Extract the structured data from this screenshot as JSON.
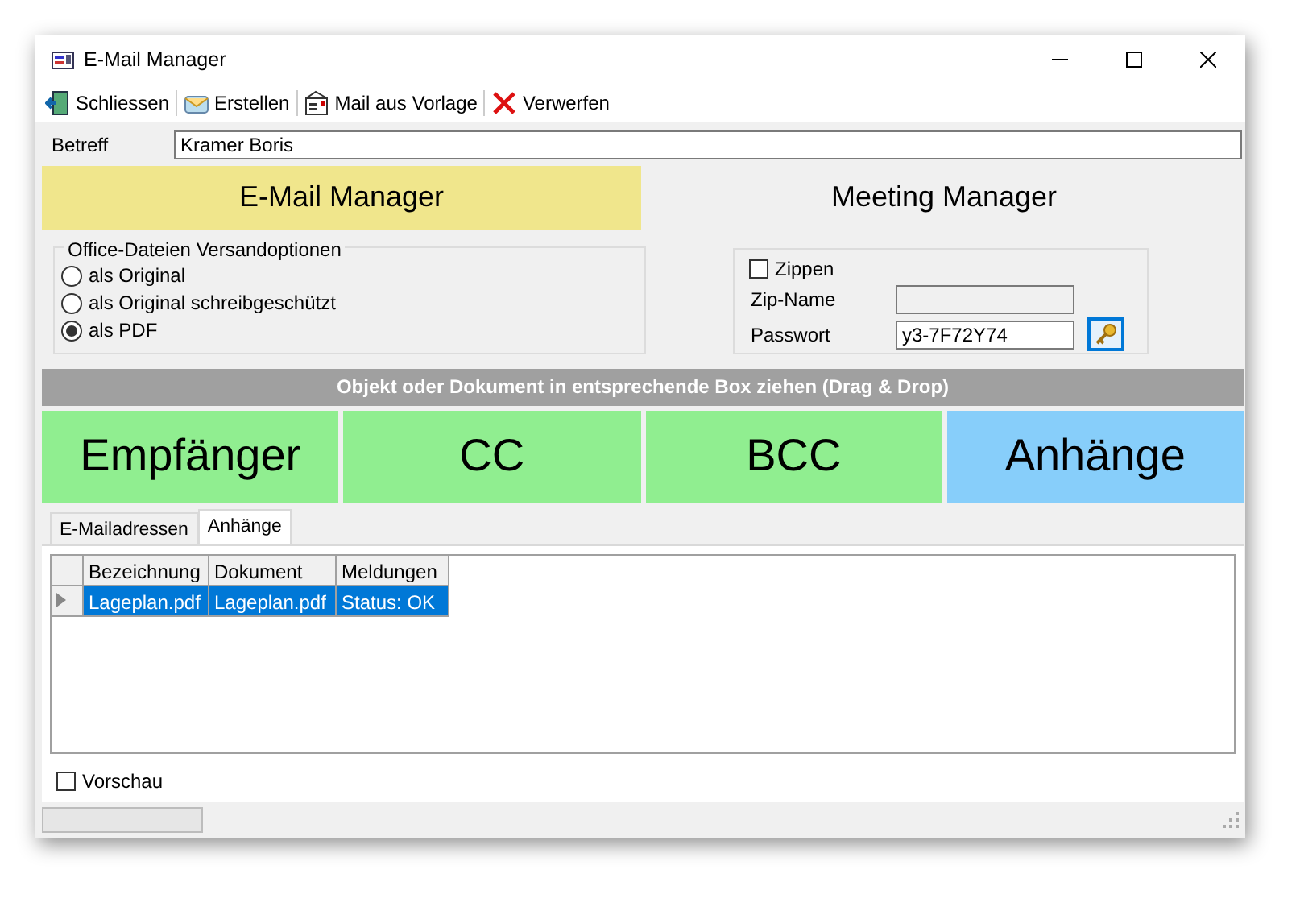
{
  "window": {
    "title": "E-Mail Manager"
  },
  "toolbar": [
    {
      "kind": "close",
      "label": "Schliessen"
    },
    {
      "kind": "create",
      "label": "Erstellen"
    },
    {
      "kind": "template",
      "label": "Mail aus Vorlage"
    },
    {
      "kind": "discard",
      "label": "Verwerfen"
    }
  ],
  "subject": {
    "label": "Betreff",
    "value": "Kramer Boris"
  },
  "managers": [
    {
      "label": "E-Mail Manager",
      "selected": true
    },
    {
      "label": "Meeting Manager",
      "selected": false
    }
  ],
  "send_options": {
    "title": "Office-Dateien Versandoptionen",
    "options": [
      {
        "label": "als Original",
        "selected": false
      },
      {
        "label": "als Original schreibgeschützt",
        "selected": false
      },
      {
        "label": "als PDF",
        "selected": true
      }
    ]
  },
  "zip": {
    "checkbox": {
      "label": "Zippen",
      "checked": false
    },
    "name_label": "Zip-Name",
    "password_label": "Passwort",
    "password": "y3-7F72Y74"
  },
  "drop_hint": "Objekt oder Dokument in entsprechende Box ziehen (Drag & Drop)",
  "drop_zones": [
    {
      "label": "Empfänger",
      "color": "#90ee90"
    },
    {
      "label": "CC",
      "color": "#90ee90"
    },
    {
      "label": "BCC",
      "color": "#90ee90"
    },
    {
      "label": "Anhänge",
      "color": "#87cefa"
    }
  ],
  "tabs": [
    {
      "label": "E-Mailadressen",
      "selected": false
    },
    {
      "label": "Anhänge",
      "selected": true
    }
  ],
  "table": {
    "columns": [
      "Bezeichnung",
      "Dokument",
      "Meldungen"
    ],
    "rows": [
      {
        "cells": [
          "Lageplan.pdf",
          "Lageplan.pdf",
          "Status: OK"
        ],
        "selected": true
      }
    ]
  },
  "preview": {
    "label": "Vorschau",
    "checked": false
  },
  "status_bar": {
    "progress": {
      "level": 0
    }
  }
}
